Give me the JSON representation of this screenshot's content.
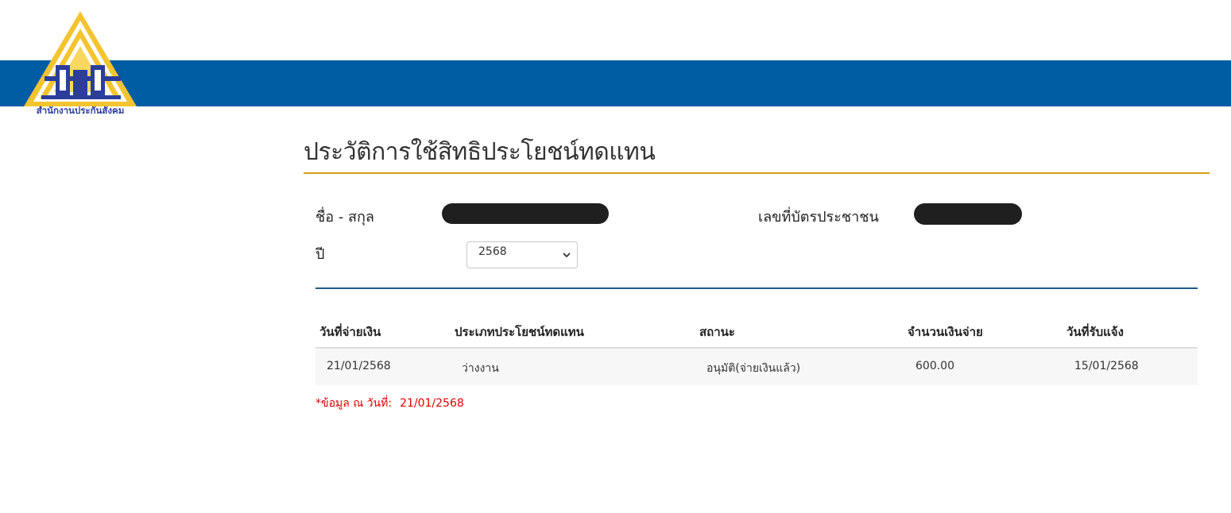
{
  "header": {
    "logo_text": "สำนักงานประกันสังคม",
    "brand_color": "#005ca3",
    "accent_color": "#d4a017"
  },
  "page": {
    "title": "ประวัติการใช้สิทธิประโยชน์ทดแทน"
  },
  "form": {
    "name_label": "ชื่อ - สกุล",
    "id_label": "เลขที่บัตรประชาชน",
    "year_label": "ปี",
    "year_selected": "2568",
    "year_options": [
      "2568"
    ]
  },
  "table": {
    "columns": [
      "วันที่จ่ายเงิน",
      "ประเภทประโยชน์ทดแทน",
      "สถานะ",
      "จำนวนเงินจ่าย",
      "วันที่รับแจ้ง"
    ],
    "rows": [
      [
        "21/01/2568",
        "ว่างงาน",
        "อนุมัติ(จ่ายเงินแล้ว)",
        "600.00",
        "15/01/2568"
      ]
    ]
  },
  "note": {
    "label": "*ข้อมูล ณ วันที่:",
    "date": "21/01/2568"
  }
}
